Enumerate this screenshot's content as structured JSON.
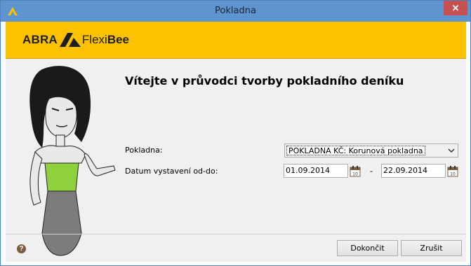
{
  "window": {
    "title": "Pokladna",
    "close_glyph": "✕"
  },
  "brand": {
    "abra": "ABRA",
    "flexi": "Flexi",
    "bee": "Bee",
    "accent": "#fcc200"
  },
  "wizard": {
    "heading": "Vítejte v průvodci tvorby pokladního deníku",
    "pokladna_label": "Pokladna:",
    "pokladna_value": "POKLADNA KČ: Korunová pokladna",
    "datum_label": "Datum vystavení od-do:",
    "date_from": "01.09.2014",
    "date_separator": "-",
    "date_to": "22.09.2014",
    "calendar_day": "10"
  },
  "footer": {
    "help_glyph": "?",
    "finish_label": "Dokončit",
    "cancel_label": "Zrušit"
  }
}
